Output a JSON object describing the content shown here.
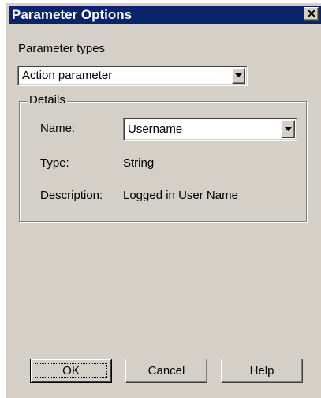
{
  "window": {
    "title": "Parameter Options"
  },
  "parameter_types": {
    "label": "Parameter types",
    "selected": "Action parameter"
  },
  "details": {
    "legend": "Details",
    "name_label": "Name:",
    "name_value": "Username",
    "type_label": "Type:",
    "type_value": "String",
    "description_label": "Description:",
    "description_value": "Logged in User Name"
  },
  "buttons": {
    "ok": "OK",
    "cancel": "Cancel",
    "help": "Help"
  },
  "colors": {
    "titlebar": "#0a246a",
    "dialog_face": "#d4d0c8"
  },
  "icons": {
    "close": "close-icon",
    "dropdown": "chevron-down-icon"
  }
}
